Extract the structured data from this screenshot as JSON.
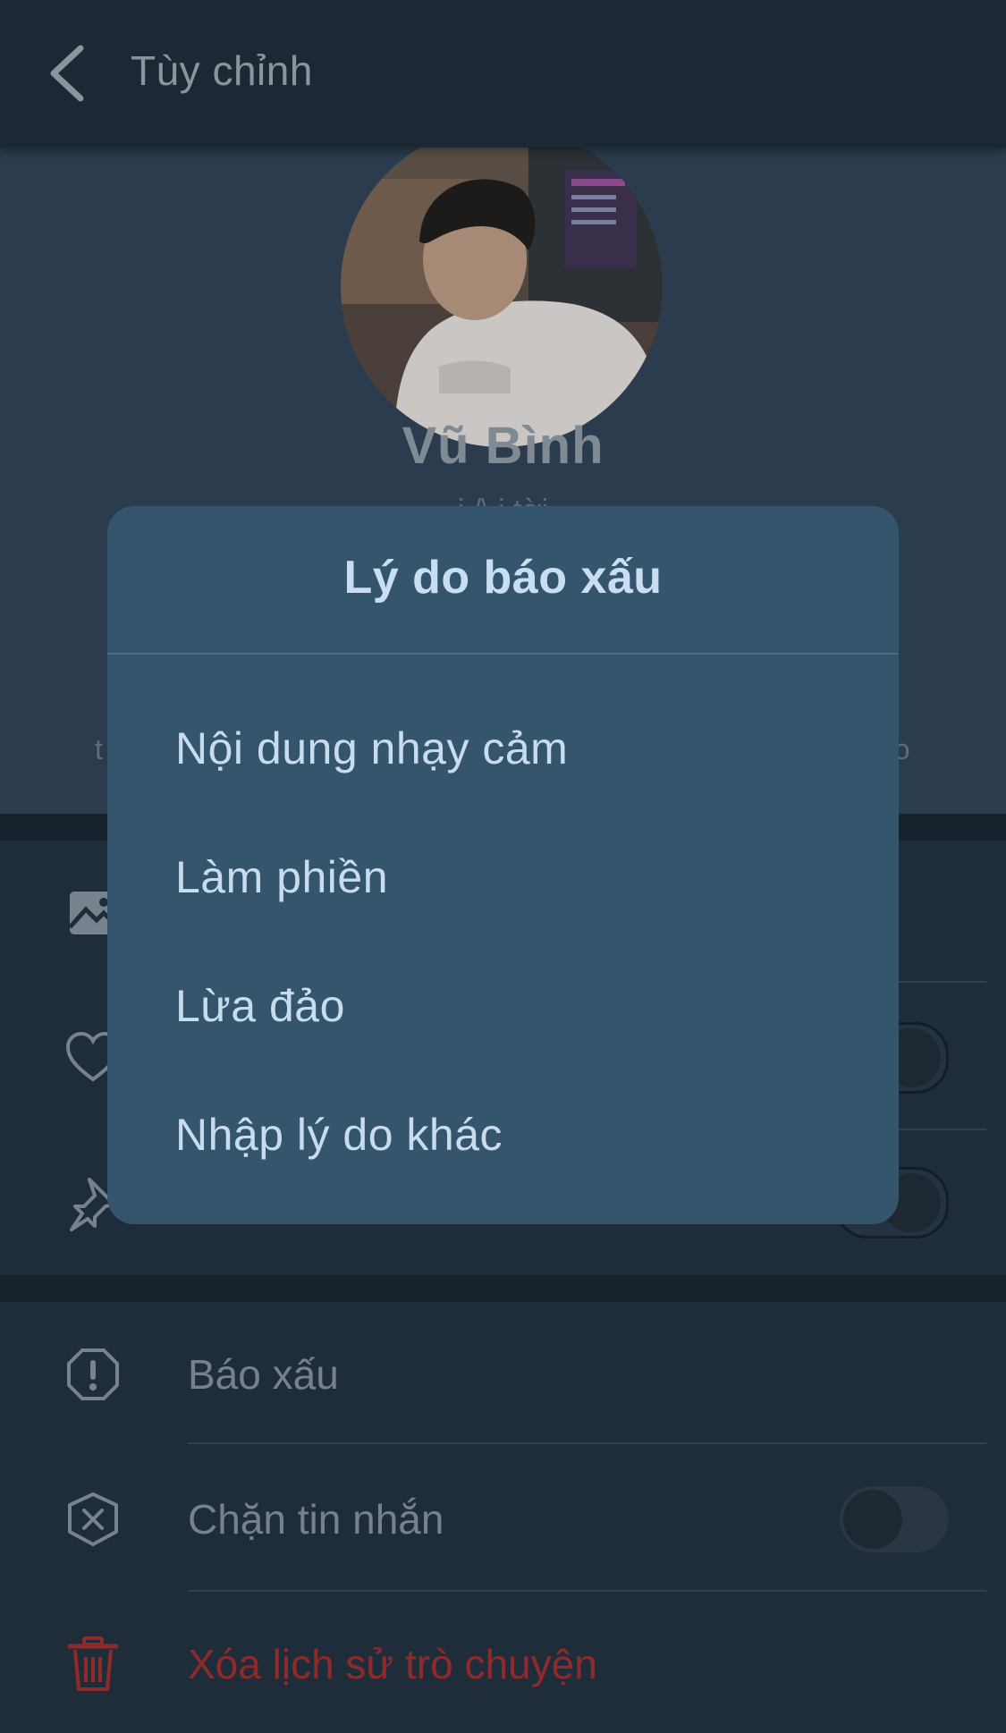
{
  "header": {
    "title": "Tùy chỉnh"
  },
  "profile": {
    "name": "Vũ Bình",
    "subtitle": "i    /\\    i    tời",
    "quick_left": "t",
    "quick_right": "áo"
  },
  "settings": {
    "rows": [
      {
        "label": "",
        "icon": "image-icon"
      },
      {
        "label": "",
        "icon": "heart-icon",
        "toggle": "on"
      },
      {
        "label": "",
        "icon": "pin-icon",
        "toggle": "on"
      }
    ]
  },
  "actions": {
    "report_label": "Báo xấu",
    "block_label": "Chặn tin nhắn",
    "block_toggle": "off",
    "delete_label": "Xóa lịch sử trò chuyện"
  },
  "modal": {
    "title": "Lý do báo xấu",
    "options": [
      "Nội dung nhạy cảm",
      "Làm phiền",
      "Lừa đảo",
      "Nhập lý do khác"
    ]
  },
  "colors": {
    "modal_bg": "#34556c",
    "modal_text": "#c8dcee",
    "danger": "#8f2a2a",
    "header_bg": "#1c2833"
  }
}
